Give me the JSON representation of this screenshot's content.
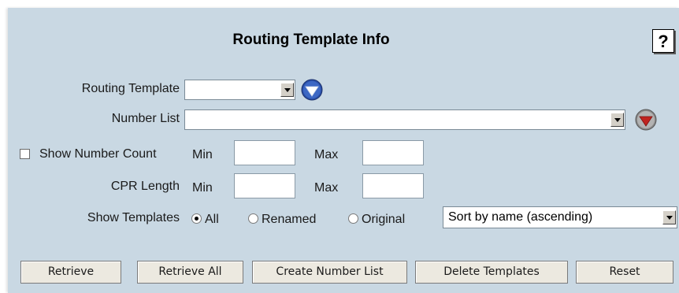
{
  "header": {
    "title": "Routing Template Info",
    "help_label": "?"
  },
  "routing_template": {
    "label": "Routing Template",
    "value": "",
    "go_icon": "blue-down-arrow-icon"
  },
  "number_list": {
    "label": "Number List",
    "value": "",
    "go_icon": "red-down-arrow-icon"
  },
  "show_number_count": {
    "label": "Show Number Count",
    "checked": false,
    "min_label": "Min",
    "max_label": "Max",
    "min_value": "",
    "max_value": ""
  },
  "cpr_length": {
    "label": "CPR Length",
    "min_label": "Min",
    "max_label": "Max",
    "min_value": "",
    "max_value": ""
  },
  "show_templates": {
    "label": "Show Templates",
    "options": [
      "All",
      "Renamed",
      "Original"
    ],
    "selected": "All",
    "sort": {
      "value": "Sort by name (ascending)"
    }
  },
  "buttons": {
    "retrieve": "Retrieve",
    "retrieve_all": "Retrieve All",
    "create_number_list": "Create Number List",
    "delete_templates": "Delete Templates",
    "reset": "Reset"
  },
  "colors": {
    "panel_bg": "#c9d8e3",
    "go_blue": "#2a4fa8",
    "go_red": "#c0231f"
  }
}
